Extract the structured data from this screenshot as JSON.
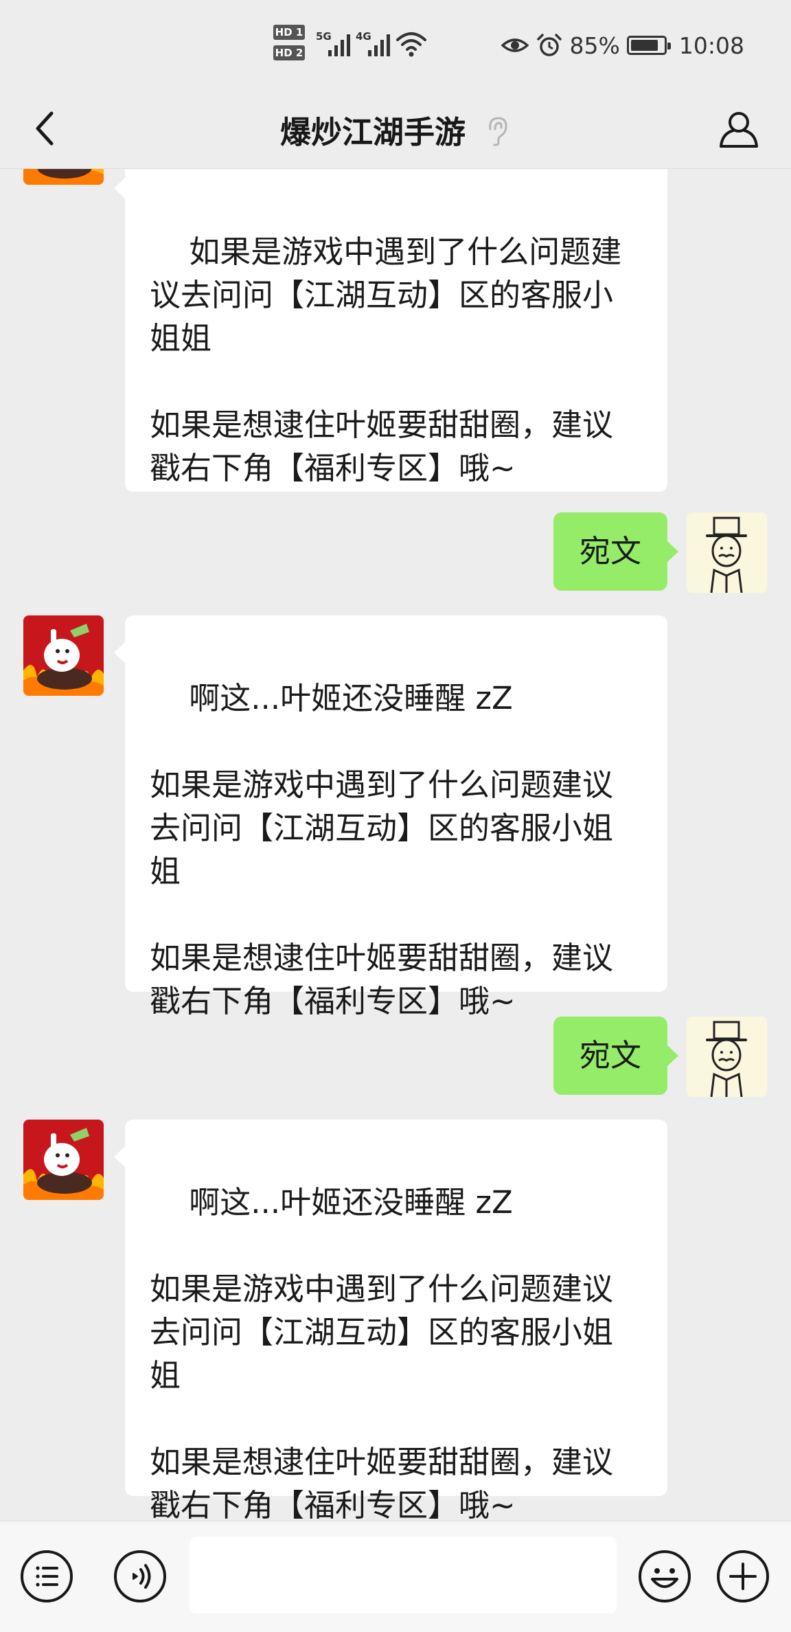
{
  "status_bar": {
    "sim1": "HD 1",
    "sim2": "HD 2",
    "net1": "5G",
    "net2": "4G",
    "battery": "85%",
    "time": "10:08"
  },
  "header": {
    "title": "爆炒江湖手游",
    "back_icon": "chevron-left-icon",
    "ear_icon": "ear-icon",
    "profile_icon": "person-icon"
  },
  "messages": [
    {
      "from": "official",
      "text": "如果是游戏中遇到了什么问题建议去问问【江湖互动】区的客服小姐姐\n\n如果是想逮住叶姬要甜甜圈，建议戳右下角【福利专区】哦~"
    },
    {
      "from": "me",
      "text": "宛文"
    },
    {
      "from": "official",
      "text": "啊这...叶姬还没睡醒 zZ\n\n如果是游戏中遇到了什么问题建议去问问【江湖互动】区的客服小姐姐\n\n如果是想逮住叶姬要甜甜圈，建议戳右下角【福利专区】哦~"
    },
    {
      "from": "me",
      "text": "宛文"
    },
    {
      "from": "official",
      "text": "啊这...叶姬还没睡醒 zZ\n\n如果是游戏中遇到了什么问题建议去问问【江湖互动】区的客服小姐姐\n\n如果是想逮住叶姬要甜甜圈，建议戳右下角【福利专区】哦~"
    }
  ],
  "input_bar": {
    "menu_icon": "menu-list-icon",
    "voice_icon": "voice-icon",
    "emoji_icon": "emoji-icon",
    "more_icon": "plus-icon",
    "input_value": ""
  },
  "colors": {
    "background": "#ededed",
    "incoming_bubble": "#ffffff",
    "outgoing_bubble": "#95ec69",
    "input_bar": "#f7f7f7"
  }
}
